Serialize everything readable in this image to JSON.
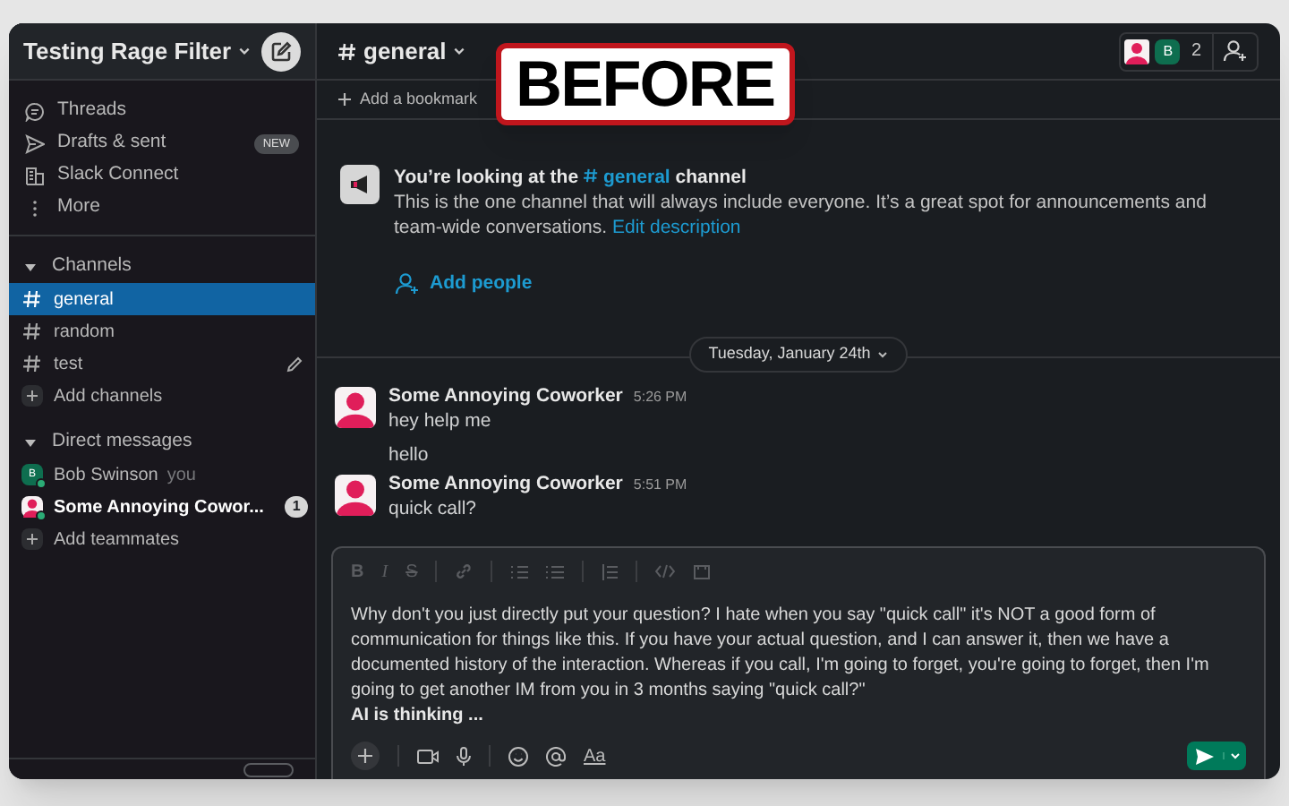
{
  "overlay_label": "BEFORE",
  "sidebar": {
    "workspace": "Testing Rage Filter",
    "top_items": [
      {
        "kind": "threads",
        "label": "Threads"
      },
      {
        "kind": "drafts",
        "label": "Drafts & sent",
        "badge": "NEW"
      },
      {
        "kind": "connect",
        "label": "Slack Connect"
      },
      {
        "kind": "more",
        "label": "More"
      }
    ],
    "sections": [
      {
        "title": "Channels",
        "expanded": true,
        "items": [
          {
            "kind": "channel",
            "label": "general",
            "selected": true
          },
          {
            "kind": "channel",
            "label": "random",
            "selected": false
          },
          {
            "kind": "channel",
            "label": "test",
            "selected": false,
            "editable": true
          },
          {
            "kind": "add",
            "label": "Add channels",
            "selected": false
          }
        ]
      },
      {
        "title": "Direct messages",
        "expanded": true,
        "items": [
          {
            "kind": "dm",
            "avatar": "B",
            "label": "Bob Swinson",
            "note": "you",
            "unread": false,
            "selected": false
          },
          {
            "kind": "dm",
            "label": "Some Annoying Cowor...",
            "unread": true,
            "count": "1",
            "selected": false
          },
          {
            "kind": "add",
            "label": "Add teammates",
            "selected": false
          }
        ]
      }
    ]
  },
  "header": {
    "channel": "general",
    "member_avatar": "B",
    "member_count": "2",
    "bookmark": "Add a bookmark"
  },
  "intro": {
    "title_before": "You’re looking at the",
    "channel": "general",
    "title_after": "channel",
    "text": "This is the one channel that will always include everyone. It’s a great spot for announcements and team-wide conversations.",
    "link": "Edit description",
    "add_people": "Add people"
  },
  "date_divider": "Tuesday, January 24th",
  "messages": [
    {
      "author": "Some Annoying Coworker",
      "time": "5:26 PM",
      "lines": [
        "hey help me",
        "hello"
      ]
    },
    {
      "author": "Some Annoying Coworker",
      "time": "5:51 PM",
      "lines": [
        "quick call?"
      ]
    }
  ],
  "composer": {
    "value": "Why don't you just directly put your question? I hate when you say \"quick call\" it's NOT a good form of communication for things like this. If you have your actual question, and I can answer it, then we have a documented history of the interaction. Whereas if you call, I'm going to forget, you're going to forget, then I'm going to get another IM from you in 3 months saying \"quick call?\"",
    "status": "AI is thinking ...",
    "format_buttons": [
      {
        "kind": "bold",
        "label": "B"
      },
      {
        "kind": "italic",
        "label": "I"
      },
      {
        "kind": "strike",
        "label": "S"
      }
    ],
    "format_label": "Aa"
  }
}
